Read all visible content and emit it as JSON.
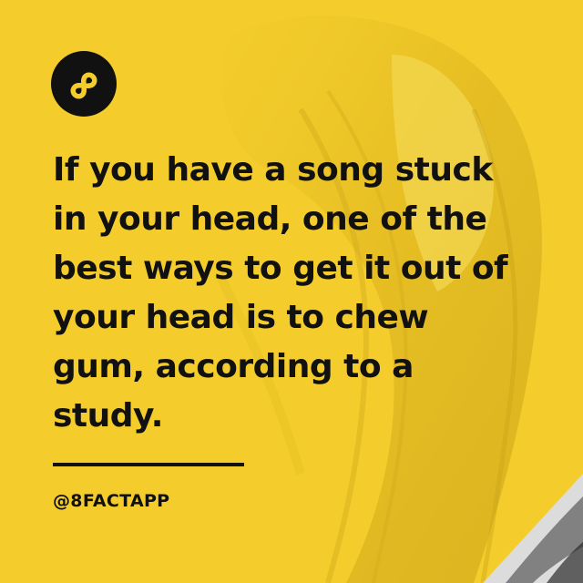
{
  "brand": {
    "logo_icon": "infinity-eight-icon",
    "handle": "@8FACTAPP"
  },
  "fact": {
    "lines": [
      "If you have a song stuck",
      "in your head, one of the",
      "best ways to get it out of",
      "your head is to chew",
      "gum, according to a",
      "study."
    ]
  },
  "colors": {
    "background": "#f4cd2c",
    "text": "#111111",
    "logo": "#111111"
  }
}
